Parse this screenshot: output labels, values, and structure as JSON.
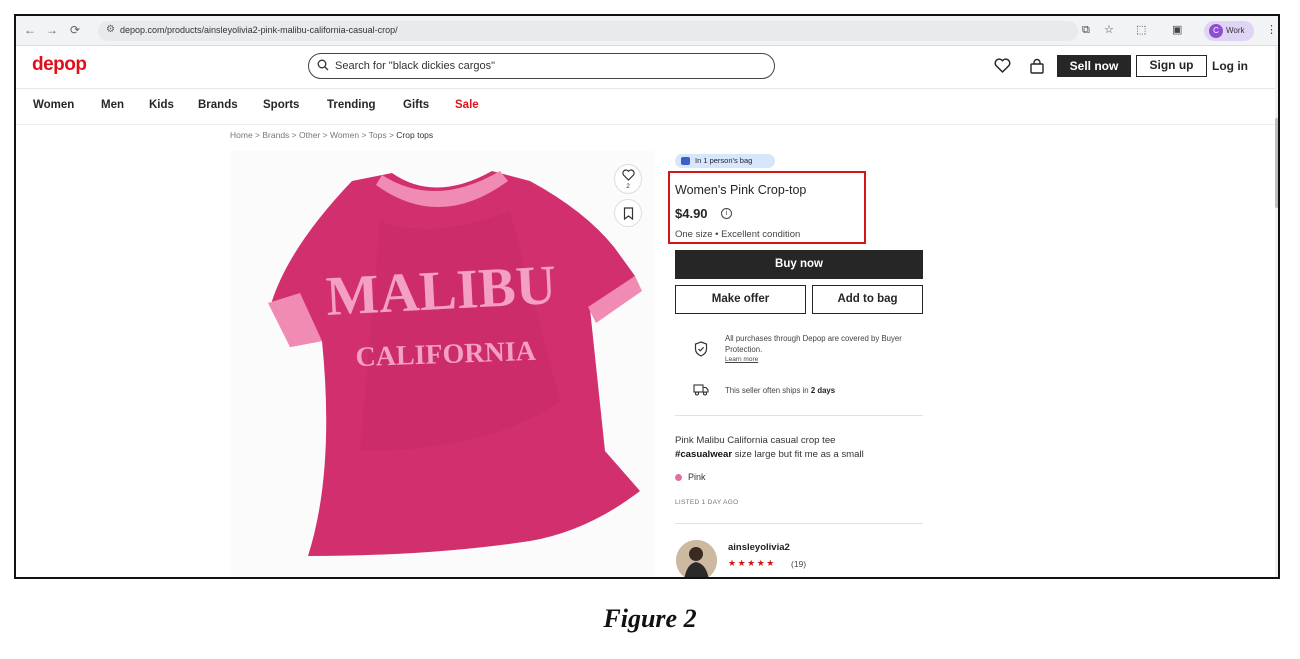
{
  "browser": {
    "url": "depop.com/products/ainsleyolivia2-pink-malibu-california-casual-crop/",
    "profile_initial": "C",
    "profile_label": "Work"
  },
  "header": {
    "logo": "depop",
    "search_value": "Search for \"black dickies cargos\"",
    "sell_label": "Sell now",
    "signup_label": "Sign up",
    "login_label": "Log in"
  },
  "categories": [
    "Women",
    "Men",
    "Kids",
    "Brands",
    "Sports",
    "Trending",
    "Gifts",
    "Sale"
  ],
  "breadcrumb": [
    "Home",
    "Brands",
    "Other",
    "Women",
    "Tops",
    "Crop tops"
  ],
  "product": {
    "bag_badge": "In 1 person's bag",
    "title": "Women's Pink Crop-top",
    "price": "$4.90",
    "condition": "One size • Excellent condition",
    "likes": "2",
    "shirt_text_1": "MALIBU",
    "shirt_text_2": "CALIFORNIA",
    "buy_label": "Buy now",
    "offer_label": "Make offer",
    "add_bag_label": "Add to bag",
    "protection_text": "All purchases through Depop are covered by Buyer Protection.",
    "learn_more": "Learn more",
    "ship_text": "This seller often ships in",
    "ship_days": "2 days",
    "desc_line1": "Pink Malibu California casual crop tee",
    "desc_hashtag": "#casualwear",
    "desc_line2": " size large but fit me as a small",
    "color": "Pink",
    "listed": "LISTED 1 DAY AGO"
  },
  "seller": {
    "name": "ainsleyolivia2",
    "stars": "★★★★★",
    "reviews": "(19)"
  },
  "colors": {
    "brand_red": "#e0101a",
    "highlight_box": "#d01818",
    "shirt_pink": "#d22f6e"
  },
  "caption": "Figure 2"
}
